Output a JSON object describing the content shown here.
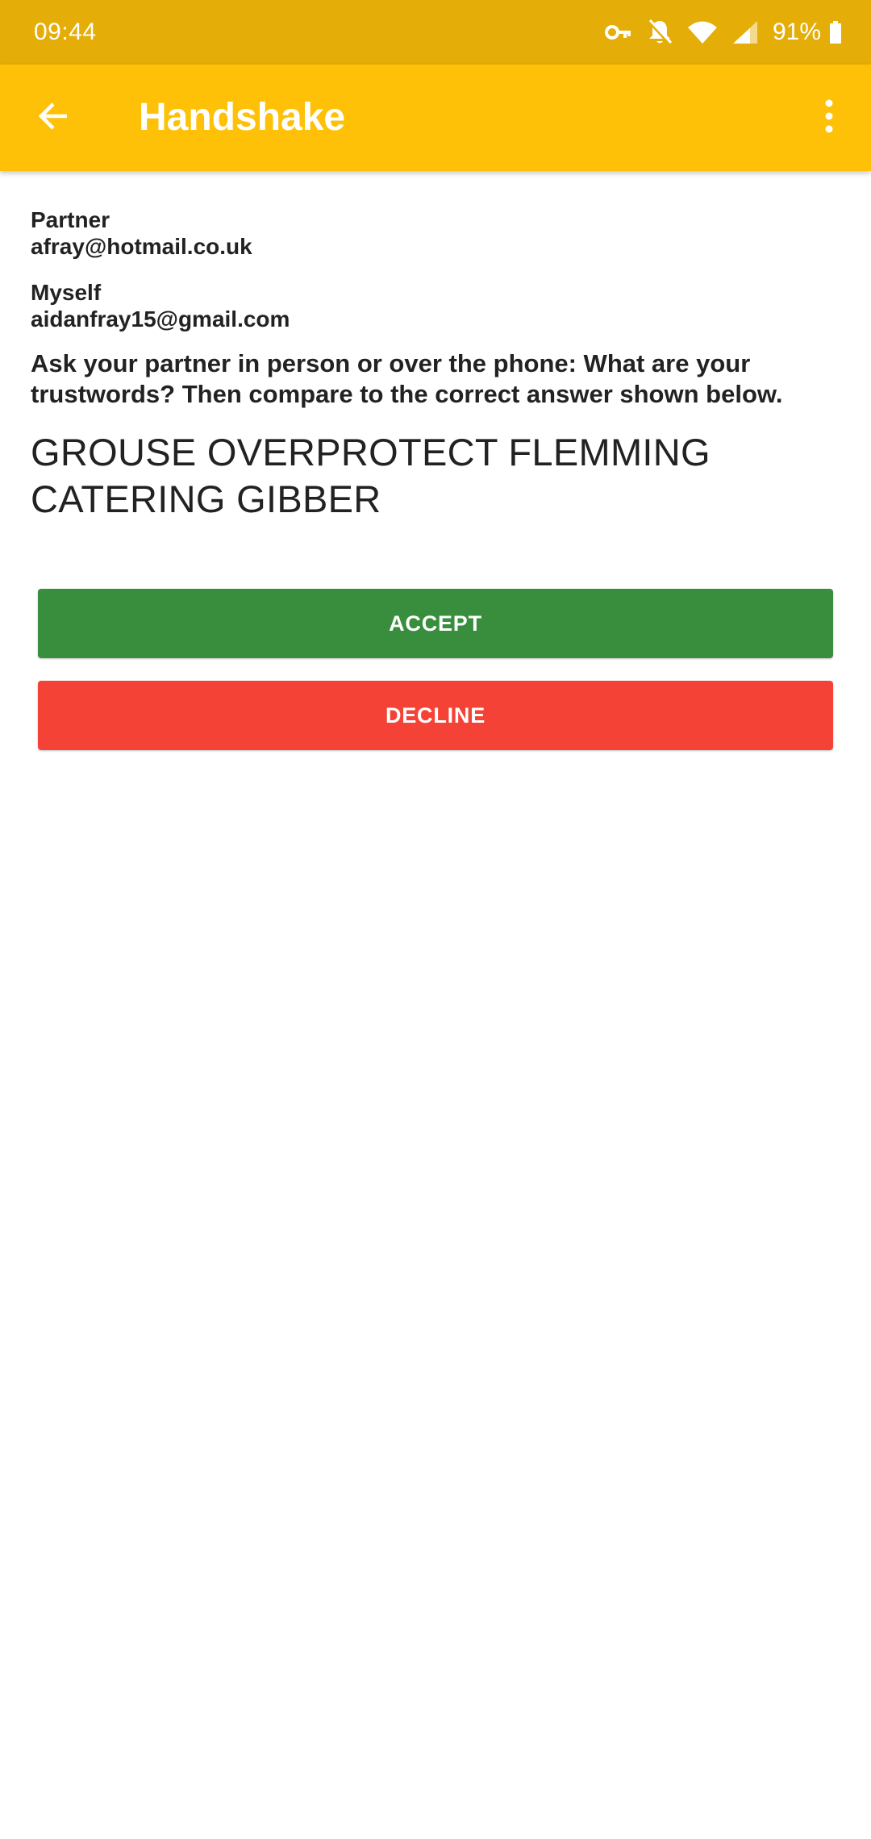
{
  "status_bar": {
    "time": "09:44",
    "battery_percent": "91%",
    "icons": [
      "vpn-key-icon",
      "notifications-off-icon",
      "wifi-icon",
      "cell-signal-icon",
      "battery-icon"
    ]
  },
  "app_bar": {
    "title": "Handshake",
    "background": "#fec107",
    "status_background": "#e5ad07",
    "icons": [
      "back-arrow-icon",
      "overflow-menu-icon"
    ]
  },
  "partner": {
    "label": "Partner",
    "email": "afray@hotmail.co.uk"
  },
  "myself": {
    "label": "Myself",
    "email": "aidanfray15@gmail.com"
  },
  "instruction": "Ask your partner in person or over the phone: What are your trustwords? Then compare to the correct answer shown below.",
  "trustwords": "GROUSE OVERPROTECT FLEMMING CATERING GIBBER",
  "buttons": {
    "accept": {
      "label": "ACCEPT",
      "color": "#388e3c"
    },
    "decline": {
      "label": "DECLINE",
      "color": "#f44336"
    }
  }
}
